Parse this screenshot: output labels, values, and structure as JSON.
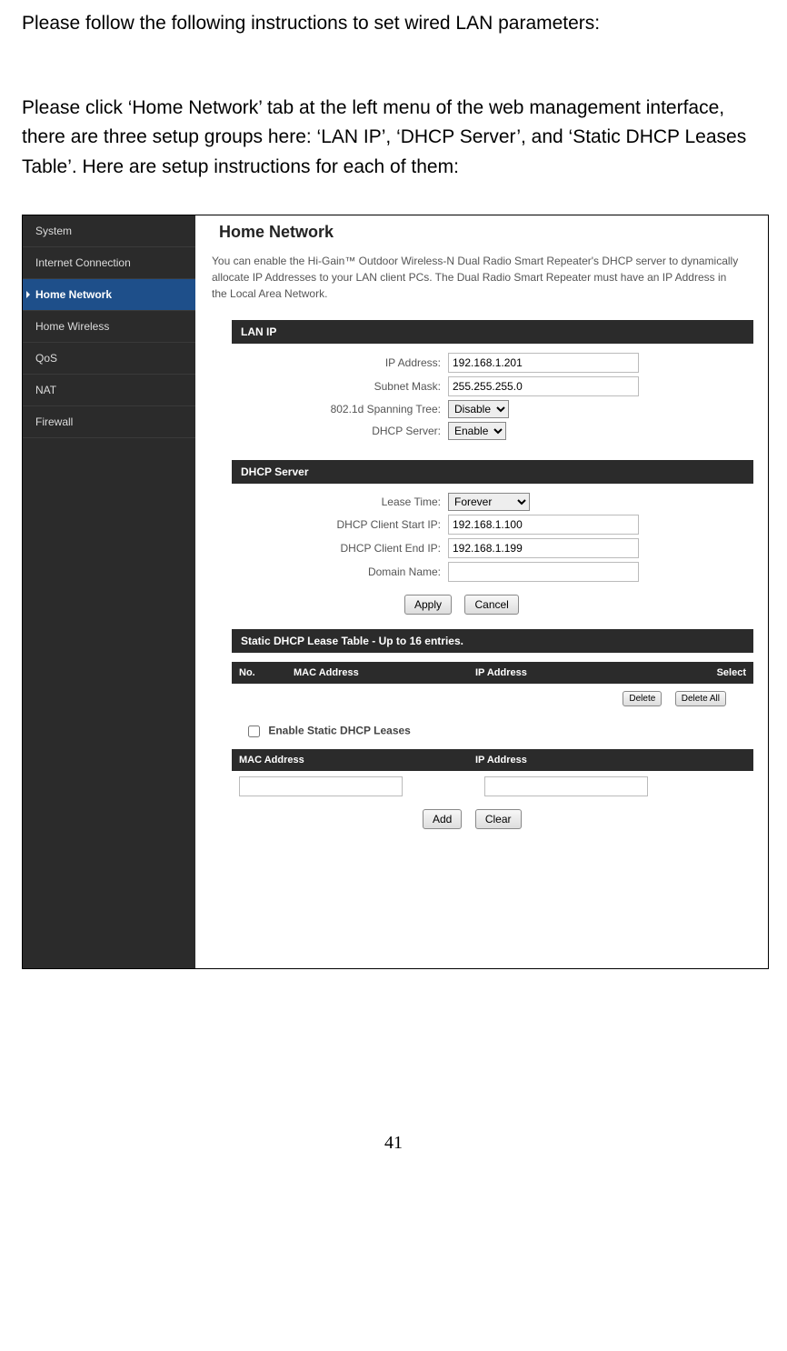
{
  "doc": {
    "para1": "Please follow the following instructions to set wired LAN parameters:",
    "para2": "Please click ‘Home Network’ tab at the left menu of the web management interface, there are three setup groups here: ‘LAN IP’, ‘DHCP Server’, and ‘Static DHCP Leases Table’. Here are setup instructions for each of them:",
    "page_number": "41"
  },
  "sidebar": {
    "items": [
      {
        "label": "System"
      },
      {
        "label": "Internet Connection"
      },
      {
        "label": "Home Network"
      },
      {
        "label": "Home Wireless"
      },
      {
        "label": "QoS"
      },
      {
        "label": "NAT"
      },
      {
        "label": "Firewall"
      }
    ]
  },
  "main": {
    "title": "Home Network",
    "intro": "You can enable the Hi-Gain™ Outdoor Wireless-N Dual Radio Smart Repeater's DHCP server to dynamically allocate IP Addresses to your LAN client PCs. The Dual Radio Smart Repeater must have an IP Address in the Local Area Network."
  },
  "sections": {
    "lan_ip_title": "LAN IP",
    "dhcp_server_title": "DHCP Server",
    "static_table_title": "Static DHCP Lease Table - Up to 16 entries."
  },
  "lan_ip": {
    "ip_label": "IP Address:",
    "ip_value": "192.168.1.201",
    "mask_label": "Subnet Mask:",
    "mask_value": "255.255.255.0",
    "span_label": "802.1d Spanning Tree:",
    "span_value": "Disable",
    "dhcp_label": "DHCP Server:",
    "dhcp_value": "Enable"
  },
  "dhcp": {
    "lease_label": "Lease Time:",
    "lease_value": "Forever",
    "start_label": "DHCP Client Start IP:",
    "start_value": "192.168.1.100",
    "end_label": "DHCP Client End IP:",
    "end_value": "192.168.1.199",
    "domain_label": "Domain Name:",
    "domain_value": ""
  },
  "buttons": {
    "apply": "Apply",
    "cancel": "Cancel",
    "delete": "Delete",
    "delete_all": "Delete All",
    "add": "Add",
    "clear": "Clear"
  },
  "static_table": {
    "cols": {
      "no": "No.",
      "mac": "MAC Address",
      "ip": "IP Address",
      "select": "Select"
    }
  },
  "static_leases": {
    "enable_label": "Enable Static DHCP Leases",
    "col_mac": "MAC Address",
    "col_ip": "IP Address"
  }
}
